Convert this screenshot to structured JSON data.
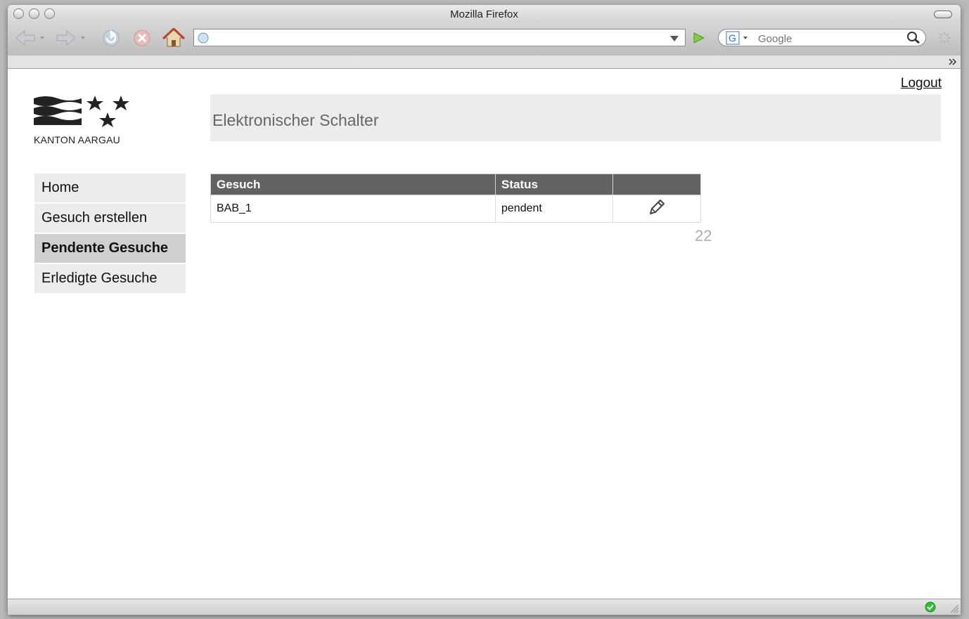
{
  "browser": {
    "title": "Mozilla Firefox",
    "url": "",
    "search_placeholder": "Google"
  },
  "page": {
    "logout_label": "Logout",
    "logo_text": "KANTON AARGAU",
    "header_title": "Elektronischer Schalter",
    "nav": [
      {
        "label": "Home",
        "active": false
      },
      {
        "label": "Gesuch erstellen",
        "active": false
      },
      {
        "label": "Pendente Gesuche",
        "active": true
      },
      {
        "label": "Erledigte Gesuche",
        "active": false
      }
    ],
    "table": {
      "headers": [
        "Gesuch",
        "Status",
        ""
      ],
      "rows": [
        {
          "gesuch": "BAB_1",
          "status": "pendent",
          "action_icon": "pencil-icon"
        }
      ]
    },
    "count": "22"
  }
}
